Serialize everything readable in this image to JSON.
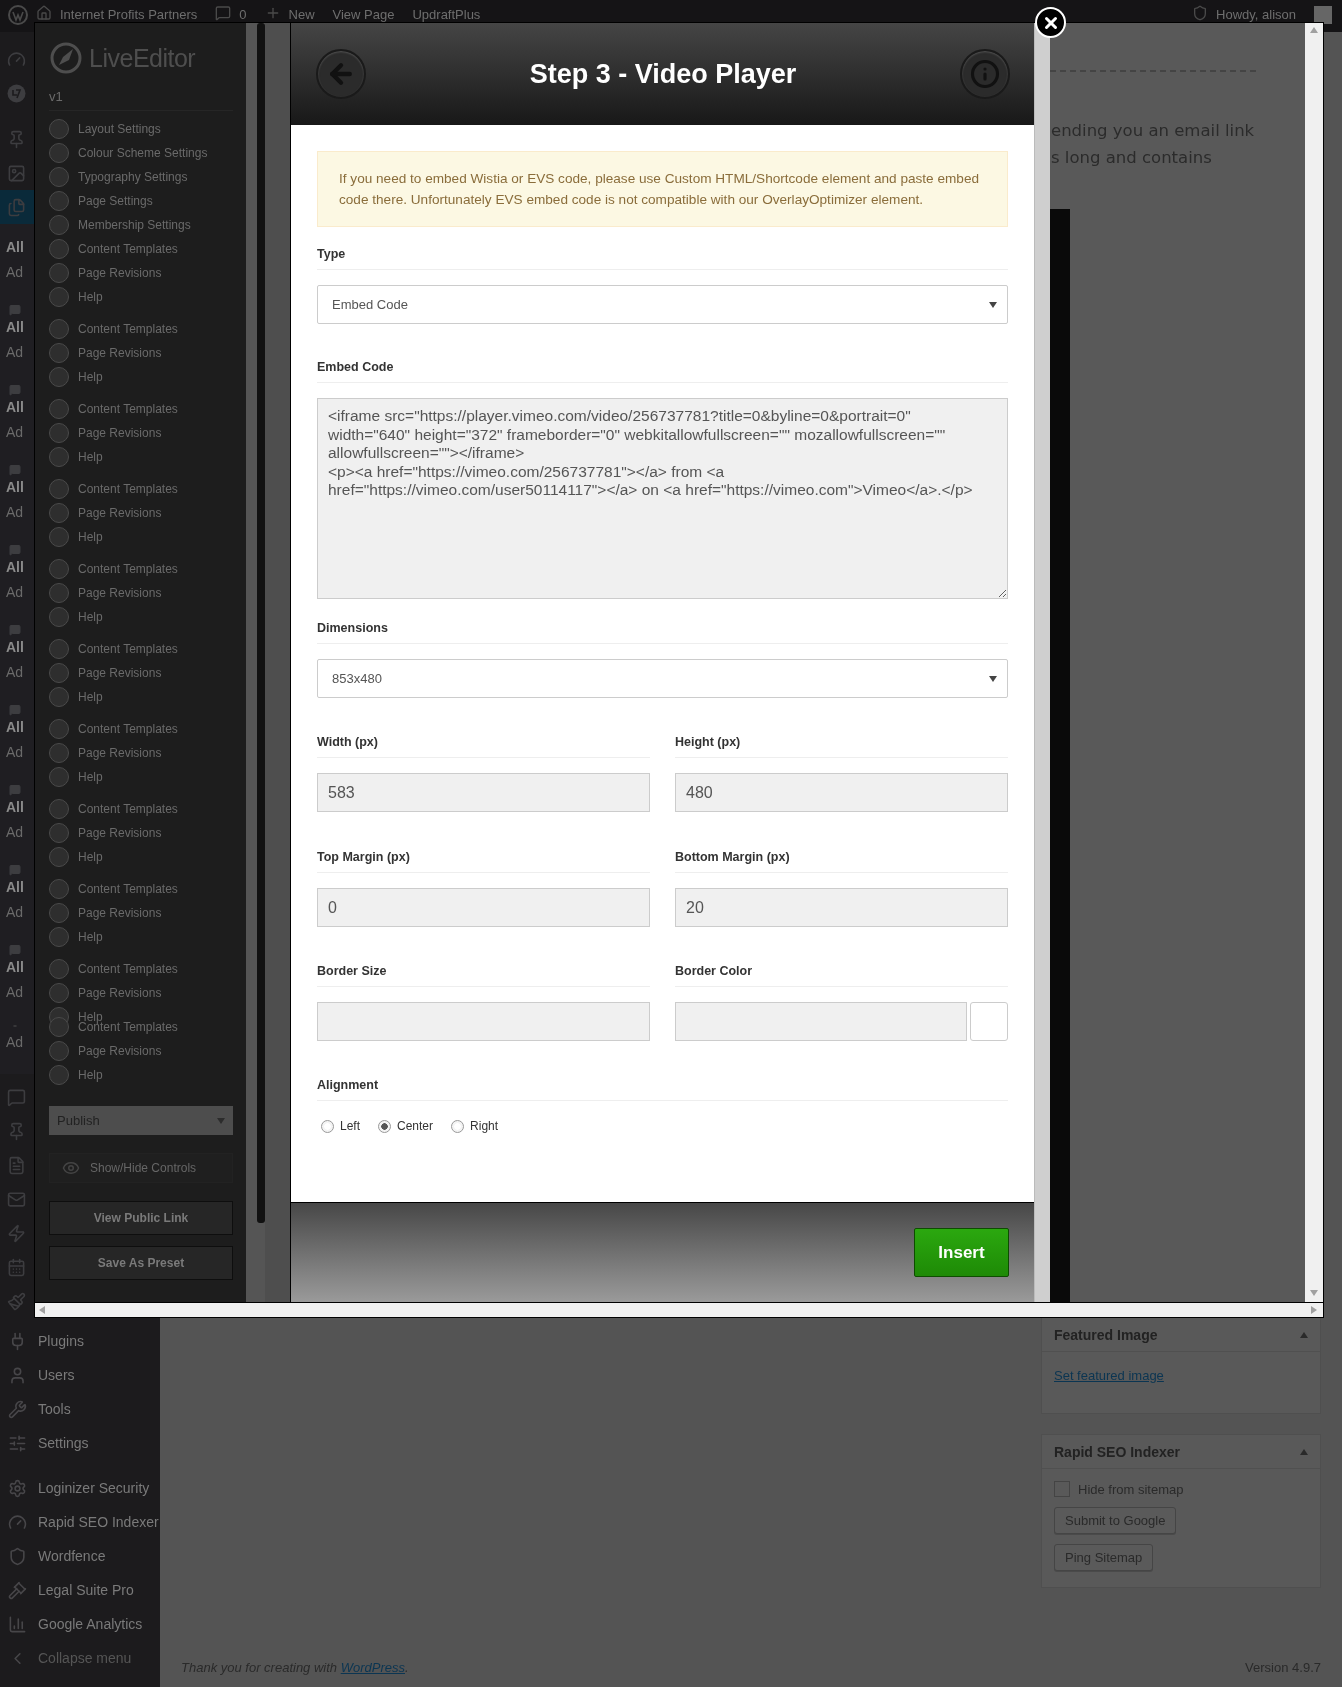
{
  "admin_bar": {
    "site": "Internet Profits Partners",
    "comments": "0",
    "new": "New",
    "view": "View Page",
    "plugin": "UpdraftPlus",
    "greeting": "Howdy, alison"
  },
  "wp_menu": {
    "covered_groups": [
      {
        "lines": [
          "All",
          "Ad"
        ]
      },
      {
        "lines": [
          "All",
          "Ad"
        ]
      },
      {
        "lines": [
          "All",
          "Ad"
        ]
      },
      {
        "lines": [
          "All",
          "Ad"
        ]
      },
      {
        "lines": [
          "All",
          "Ad"
        ]
      },
      {
        "lines": [
          "All",
          "Ad"
        ]
      },
      {
        "lines": [
          "All",
          "Ad"
        ]
      },
      {
        "lines": [
          "All",
          "Ad"
        ]
      },
      {
        "lines": [
          "All",
          "Ad"
        ]
      },
      {
        "lines": [
          "All",
          "Ad"
        ]
      },
      {
        "lines": [
          "Ad"
        ]
      }
    ],
    "items": [
      {
        "label": "Plugins"
      },
      {
        "label": "Users"
      },
      {
        "label": "Tools"
      },
      {
        "label": "Settings"
      },
      {
        "label": "Loginizer Security"
      },
      {
        "label": "Rapid SEO Indexer"
      },
      {
        "label": "Wordfence"
      },
      {
        "label": "Legal Suite Pro"
      },
      {
        "label": "Google Analytics"
      },
      {
        "label": "Collapse menu"
      }
    ]
  },
  "editor_panel": {
    "logo": "**Live**Editor",
    "version": "v1",
    "menu_groups": [
      {
        "items": [
          "Layout Settings",
          "Colour Scheme Settings",
          "Typography Settings",
          "Page Settings",
          "Membership Settings",
          "Content Templates",
          "Page Revisions",
          "Help"
        ]
      },
      {
        "items": [
          "Content Templates",
          "Page Revisions",
          "Help"
        ]
      },
      {
        "items": [
          "Content Templates",
          "Page Revisions",
          "Help"
        ]
      },
      {
        "items": [
          "Content Templates",
          "Page Revisions",
          "Help"
        ]
      },
      {
        "items": [
          "Content Templates",
          "Page Revisions",
          "Help"
        ]
      },
      {
        "items": [
          "Content Templates",
          "Page Revisions",
          "Help"
        ]
      },
      {
        "items": [
          "Content Templates",
          "Page Revisions",
          "Help"
        ]
      },
      {
        "items": [
          "Content Templates",
          "Page Revisions",
          "Help"
        ]
      },
      {
        "items": [
          "Content Templates",
          "Page Revisions",
          "Help"
        ]
      },
      {
        "items": [
          "Content Templates",
          "Page Revisions",
          "Help"
        ]
      },
      {
        "items": [
          "Content Templates",
          "Page Revisions",
          "Help"
        ]
      }
    ],
    "status_select": "Publish",
    "toggle": "Show/Hide Controls",
    "buttons": [
      "View Public Link",
      "Save As Preset"
    ]
  },
  "modal": {
    "title": "Step 3 - Video Player",
    "notice": "If you need to embed Wistia or EVS code, please use Custom HTML/Shortcode element and paste embed code there. Unfortunately EVS embed code is not compatible with our OverlayOptimizer element.",
    "rows": [
      {
        "fields": [
          {
            "label": "Type",
            "kind": "select",
            "value": "Embed Code"
          }
        ]
      },
      {
        "fields": [
          {
            "label": "Embed Code",
            "kind": "textarea",
            "value": "<iframe src=\"https://player.vimeo.com/video/256737781?title=0&byline=0&portrait=0\" width=\"640\" height=\"372\" frameborder=\"0\" webkitallowfullscreen=\"\" mozallowfullscreen=\"\" allowfullscreen=\"\"></iframe>\n<p><a href=\"https://vimeo.com/256737781\"></a> from <a href=\"https://vimeo.com/user50114117\"></a> on <a href=\"https://vimeo.com\">Vimeo</a>.</p>"
          }
        ]
      },
      {
        "fields": [
          {
            "label": "Dimensions",
            "kind": "select",
            "value": "853x480"
          }
        ]
      },
      {
        "fields": [
          {
            "label": "Width (px)",
            "kind": "input",
            "value": "583"
          },
          {
            "label": "Height (px)",
            "kind": "input",
            "value": "480"
          }
        ]
      },
      {
        "fields": [
          {
            "label": "Top Margin (px)",
            "kind": "input",
            "value": "0"
          },
          {
            "label": "Bottom Margin (px)",
            "kind": "input",
            "value": "20"
          }
        ]
      },
      {
        "fields": [
          {
            "label": "Border Size",
            "kind": "input"
          },
          {
            "label": "Border Color",
            "kind": "color"
          }
        ]
      },
      {
        "fields": [
          {
            "label": "Alignment",
            "kind": "radio",
            "options": [
              {
                "label": "Left",
                "selected": false
              },
              {
                "label": "Center",
                "selected": true
              },
              {
                "label": "Right",
                "selected": false
              }
            ]
          }
        ]
      }
    ],
    "insert": "Insert"
  },
  "page_preview": {
    "lines": [
      "ending you an email link",
      "s long and contains"
    ]
  },
  "sidebar": {
    "featured": {
      "title": "Featured Image",
      "link": "Set featured image"
    },
    "seo": {
      "title": "Rapid SEO Indexer",
      "checkbox": {
        "label": "Hide from sitemap",
        "checked": false
      },
      "buttons": [
        "Submit to Google",
        "Ping Sitemap"
      ]
    }
  },
  "footer": {
    "text": "Thank you for creating with ",
    "link": "WordPress",
    "end": "."
  },
  "version": "Version 4.9.7"
}
